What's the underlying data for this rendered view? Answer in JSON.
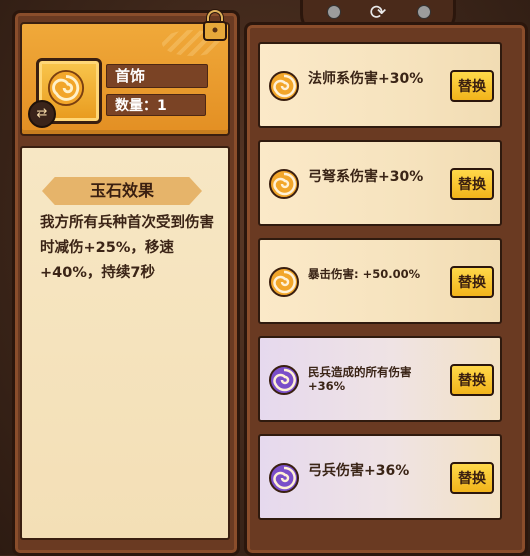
{
  "item": {
    "name": "首饰",
    "quantity_label": "数量：1"
  },
  "effect": {
    "title": "玉石效果",
    "description": "我方所有兵种首次受到伤害时减伤+25%，移速+40%，持续7秒"
  },
  "options": [
    {
      "text": "法师系伤害+30%",
      "tier": "gold",
      "button": "替换"
    },
    {
      "text": "弓弩系伤害+30%",
      "tier": "gold",
      "button": "替换"
    },
    {
      "text": "暴击伤害: +50.00%",
      "tier": "gold",
      "button": "替换"
    },
    {
      "text": "民兵造成的所有伤害+36%",
      "tier": "purple",
      "button": "替换"
    },
    {
      "text": "弓兵伤害+36%",
      "tier": "purple",
      "button": "替换"
    }
  ],
  "colors": {
    "gold_swirl": "#f2a62a",
    "purple_swirl": "#7a4fc9",
    "button": "#f9c52c"
  }
}
